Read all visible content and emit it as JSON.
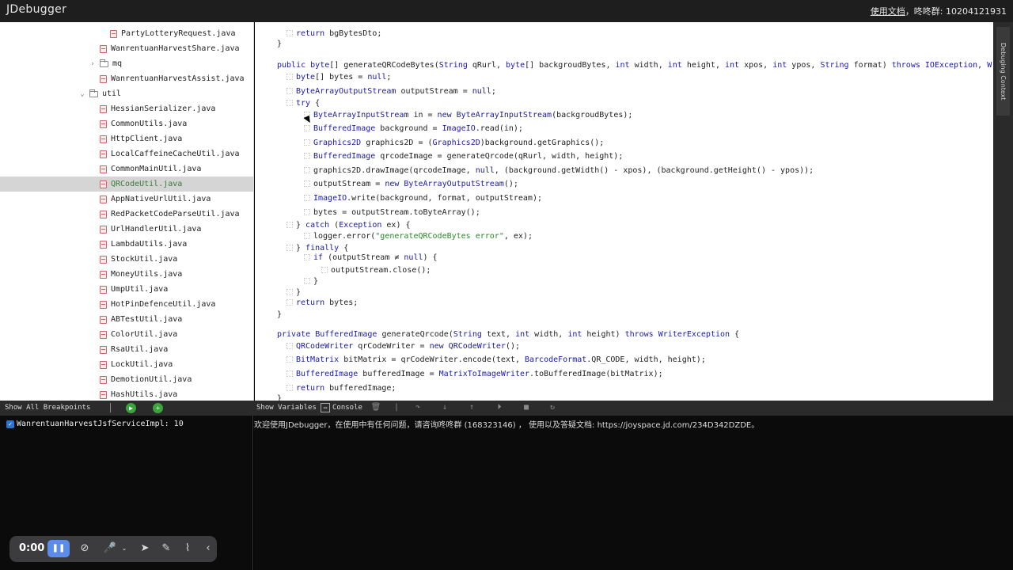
{
  "titlebar": {
    "title": "JDebugger",
    "docs_link": "使用文档",
    "group_label": "，咚咚群: 10204121931"
  },
  "tree": {
    "items": [
      {
        "label": "PartyLotteryRequest.java",
        "kind": "file"
      },
      {
        "label": "WanrentuanHarvestShare.java",
        "kind": "file"
      },
      {
        "label": "mq",
        "kind": "folder",
        "chevron": "›"
      },
      {
        "label": "WanrentuanHarvestAssist.java",
        "kind": "file"
      },
      {
        "label": "util",
        "kind": "folder",
        "chevron": "⌄"
      },
      {
        "label": "HessianSerializer.java",
        "kind": "file"
      },
      {
        "label": "CommonUtils.java",
        "kind": "file"
      },
      {
        "label": "HttpClient.java",
        "kind": "file"
      },
      {
        "label": "LocalCaffeineCacheUtil.java",
        "kind": "file"
      },
      {
        "label": "CommonMainUtil.java",
        "kind": "file"
      },
      {
        "label": "QRCodeUtil.java",
        "kind": "file",
        "selected": true
      },
      {
        "label": "AppNativeUrlUtil.java",
        "kind": "file"
      },
      {
        "label": "RedPacketCodeParseUtil.java",
        "kind": "file"
      },
      {
        "label": "UrlHandlerUtil.java",
        "kind": "file"
      },
      {
        "label": "LambdaUtils.java",
        "kind": "file"
      },
      {
        "label": "StockUtil.java",
        "kind": "file"
      },
      {
        "label": "MoneyUtils.java",
        "kind": "file"
      },
      {
        "label": "UmpUtil.java",
        "kind": "file"
      },
      {
        "label": "HotPinDefenceUtil.java",
        "kind": "file"
      },
      {
        "label": "ABTestUtil.java",
        "kind": "file"
      },
      {
        "label": "ColorUtil.java",
        "kind": "file"
      },
      {
        "label": "RsaUtil.java",
        "kind": "file"
      },
      {
        "label": "LockUtil.java",
        "kind": "file"
      },
      {
        "label": "DemotionUtil.java",
        "kind": "file"
      },
      {
        "label": "HashUtils.java",
        "kind": "file"
      }
    ]
  },
  "code": {
    "lines": [
      {
        "indent": 2,
        "text": "return bgBytesDto;"
      },
      {
        "indent": 1,
        "text": "}"
      },
      {
        "indent": 0,
        "text": ""
      },
      {
        "indent": 1,
        "text": "public byte[] generateQRCodeBytes(String qRurl, byte[] backgroudBytes, int width, int height, int xpos, int ypos, String format) throws IOException, WriterException {"
      },
      {
        "indent": 2,
        "text": "byte[] bytes = null;"
      },
      {
        "indent": 2,
        "text": "ByteArrayOutputStream outputStream = null;"
      },
      {
        "indent": 2,
        "text": "try {"
      },
      {
        "indent": 3,
        "text": "ByteArrayInputStream in = new ByteArrayInputStream(backgroudBytes);"
      },
      {
        "indent": 3,
        "text": "BufferedImage background = ImageIO.read(in);"
      },
      {
        "indent": 3,
        "text": "Graphics2D graphics2D = (Graphics2D)background.getGraphics();"
      },
      {
        "indent": 3,
        "text": "BufferedImage qrcodeImage = generateQrcode(qRurl, width, height);"
      },
      {
        "indent": 3,
        "text": "graphics2D.drawImage(qrcodeImage, null, (background.getWidth() - xpos), (background.getHeight() - ypos));"
      },
      {
        "indent": 3,
        "text": "outputStream = new ByteArrayOutputStream();"
      },
      {
        "indent": 3,
        "text": "ImageIO.write(background, format, outputStream);"
      },
      {
        "indent": 3,
        "text": "bytes = outputStream.toByteArray();"
      },
      {
        "indent": 2,
        "text": "} catch (Exception ex) {"
      },
      {
        "indent": 3,
        "text": "logger.error(\"generateQRCodeBytes error\", ex);"
      },
      {
        "indent": 2,
        "text": "} finally {"
      },
      {
        "indent": 3,
        "text": "if (outputStream ≠ null) {"
      },
      {
        "indent": 4,
        "text": "outputStream.close();"
      },
      {
        "indent": 3,
        "text": "}"
      },
      {
        "indent": 2,
        "text": "}"
      },
      {
        "indent": 2,
        "text": "return bytes;"
      },
      {
        "indent": 1,
        "text": "}"
      },
      {
        "indent": 0,
        "text": ""
      },
      {
        "indent": 1,
        "text": "private BufferedImage generateQrcode(String text, int width, int height) throws WriterException {"
      },
      {
        "indent": 2,
        "text": "QRCodeWriter qrCodeWriter = new QRCodeWriter();"
      },
      {
        "indent": 2,
        "text": "BitMatrix bitMatrix = qrCodeWriter.encode(text, BarcodeFormat.QR_CODE, width, height);"
      },
      {
        "indent": 2,
        "text": "BufferedImage bufferedImage = MatrixToImageWriter.toBufferedImage(bitMatrix);"
      },
      {
        "indent": 2,
        "text": "return bufferedImage;"
      },
      {
        "indent": 1,
        "text": "}"
      }
    ]
  },
  "rstrip": {
    "tab_label": "Debuging Context"
  },
  "left_toolbar": {
    "label": "Show All Breakpoints",
    "resume_icon": "play-icon",
    "add_icon": "plus-icon"
  },
  "right_toolbar": {
    "show_variables": "Show Variables",
    "console": "Console"
  },
  "breakpoints": [
    {
      "label": "WanrentuanHarvestJsfServiceImpl: 10",
      "checked": true
    }
  ],
  "console": {
    "text": "欢迎使用JDebugger，在使用中有任何问题，请咨询咚咚群 (168323146) ， 使用以及答疑文档: https://joyspace.jd.com/234D342DZDE。"
  },
  "recorder": {
    "time": "0:00"
  },
  "colors": {
    "accent": "#5b8ce8",
    "keyword": "#1a1aa6",
    "string": "#2a8a2a",
    "selected_file": "#3a7a3a"
  }
}
